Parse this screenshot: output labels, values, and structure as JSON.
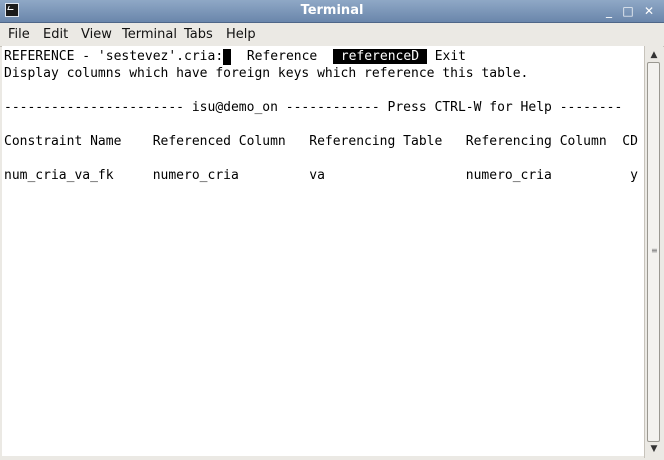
{
  "window": {
    "title": "Terminal"
  },
  "titlebar_buttons": {
    "minimize": "_",
    "maximize": "□",
    "close": "✕"
  },
  "menu": [
    "File",
    "Edit",
    "View",
    "Terminal",
    "Tabs",
    "Help"
  ],
  "terminal": {
    "prompt": "REFERENCE - 'sestevez'.cria:",
    "options": {
      "reference": "Reference",
      "referenced": "referenceD",
      "exit": "Exit"
    },
    "description": "Display columns which have foreign keys which reference this table.",
    "status_line": "----------------------- isu@demo_on ------------ Press CTRL-W for Help --------",
    "header": "Constraint Name    Referenced Column   Referencing Table   Referencing Column  CD",
    "rows": [
      "num_cria_va_fk     numero_cria         va                  numero_cria          y"
    ]
  },
  "icons": {
    "app": "terminal-icon",
    "scroll_up": "arrow-up-icon",
    "scroll_down": "arrow-down-icon"
  }
}
